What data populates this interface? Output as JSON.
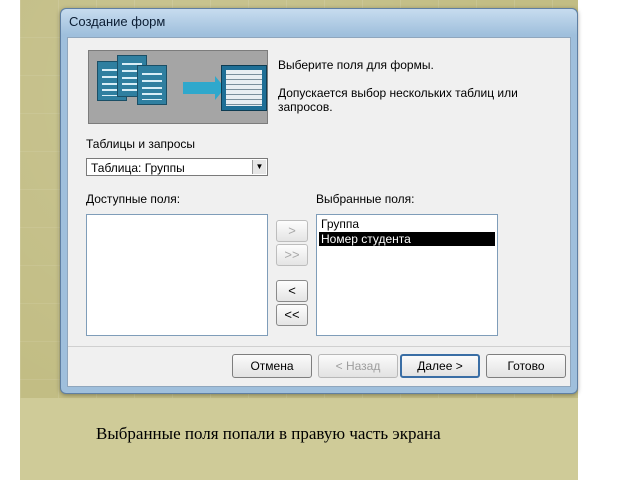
{
  "dialog": {
    "title": "Создание форм",
    "instruction": "Выберите поля для формы.",
    "note": "Допускается выбор нескольких таблиц или запросов."
  },
  "tables": {
    "label": "Таблицы и запросы",
    "selected": "Таблица: Группы"
  },
  "available": {
    "label": "Доступные поля:",
    "items": []
  },
  "chosen": {
    "label": "Выбранные поля:",
    "items": [
      "Группа",
      "Номер студента"
    ],
    "selected_index": 1
  },
  "move_buttons": {
    "add_one": ">",
    "add_all": ">>",
    "remove_one": "<",
    "remove_all": "<<"
  },
  "footer": {
    "cancel": "Отмена",
    "back": "< Назад",
    "next": "Далее >",
    "finish": "Готово"
  },
  "caption": "Выбранные поля попали в правую часть экрана",
  "icons": [
    "tables-illustration-icon",
    "arrow-right-icon",
    "form-illustration-icon",
    "dropdown-arrow-icon"
  ],
  "colors": {
    "dialog_frame": "#9fbfdc",
    "selection": "#000000",
    "slide_bg": "#c2bd84"
  }
}
